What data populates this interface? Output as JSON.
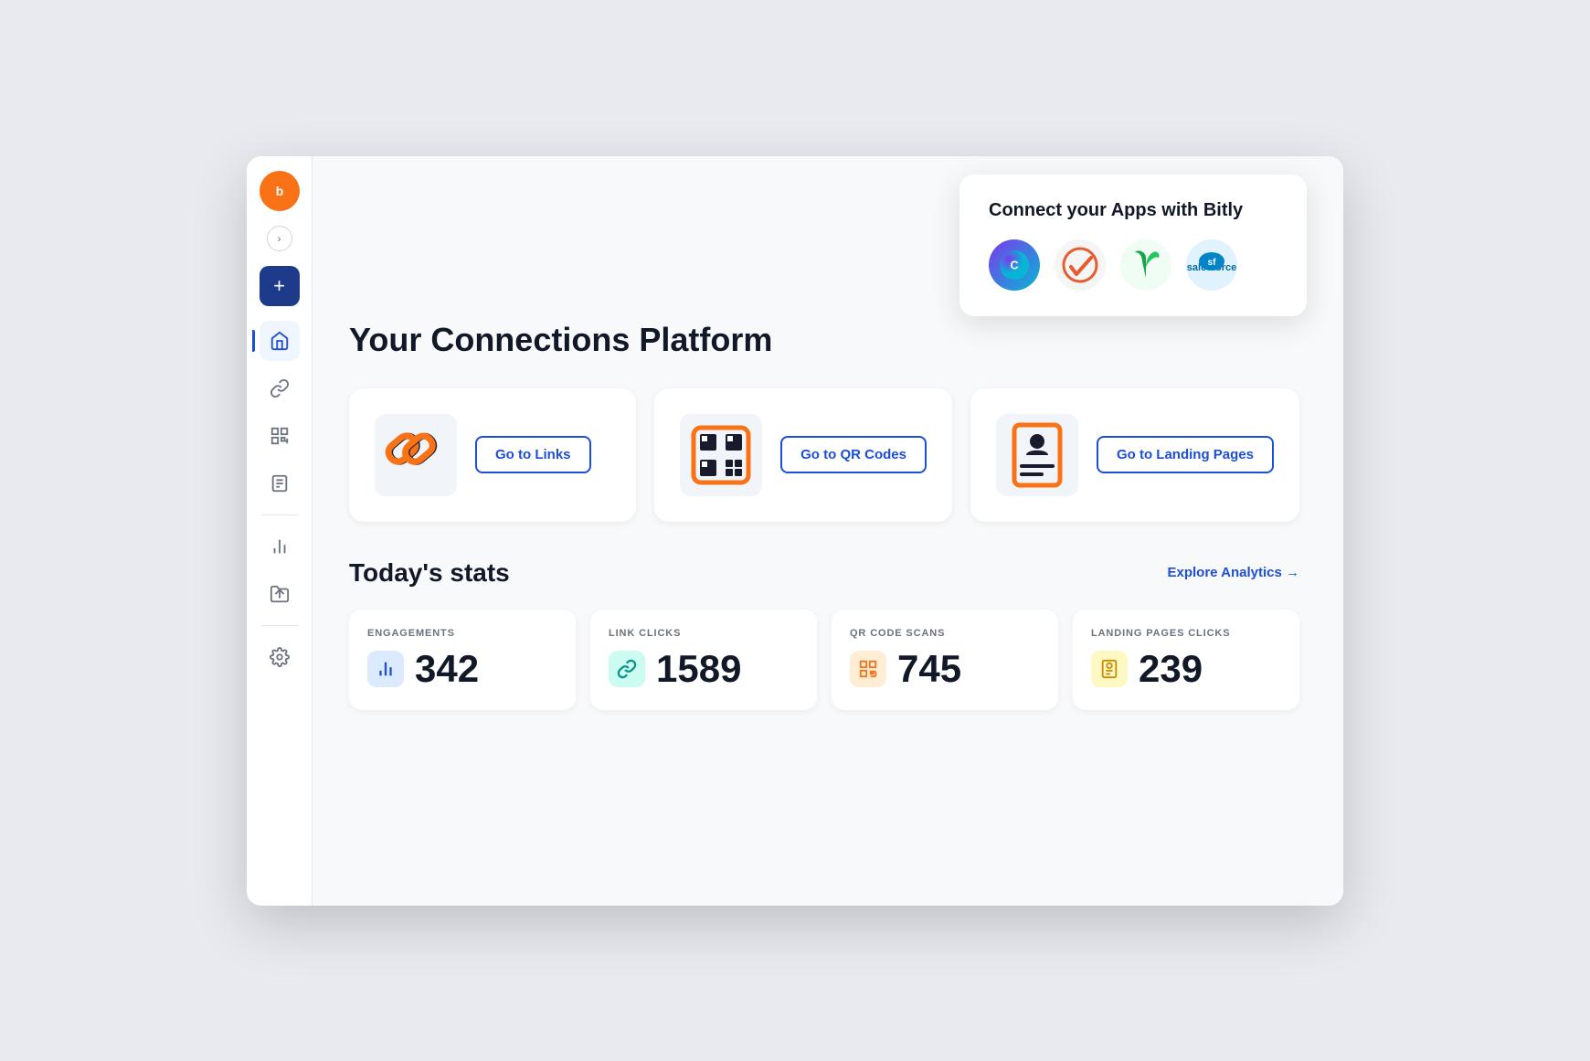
{
  "sidebar": {
    "logo_alt": "Bitly logo",
    "toggle_label": ">",
    "create_label": "+",
    "items": [
      {
        "id": "home",
        "label": "Home",
        "active": true
      },
      {
        "id": "links",
        "label": "Links",
        "active": false
      },
      {
        "id": "qr-codes",
        "label": "QR Codes",
        "active": false
      },
      {
        "id": "pages",
        "label": "Landing Pages",
        "active": false
      },
      {
        "id": "analytics",
        "label": "Analytics",
        "active": false
      },
      {
        "id": "campaigns",
        "label": "Campaigns",
        "active": false
      }
    ]
  },
  "connect_card": {
    "title": "Connect your Apps with Bitly",
    "apps": [
      {
        "id": "canva",
        "label": "Canva"
      },
      {
        "id": "check",
        "label": "Check"
      },
      {
        "id": "sprout",
        "label": "Sprout"
      },
      {
        "id": "salesforce",
        "label": "Salesforce"
      }
    ]
  },
  "main": {
    "page_title": "Your Connections Platform",
    "nav_cards": [
      {
        "id": "links",
        "button_label": "Go to Links"
      },
      {
        "id": "qr-codes",
        "button_label": "Go to QR Codes"
      },
      {
        "id": "landing-pages",
        "button_label": "Go to Landing Pages"
      }
    ],
    "stats": {
      "title": "Today's stats",
      "explore_label": "Explore Analytics →",
      "items": [
        {
          "id": "engagements",
          "label": "ENGAGEMENTS",
          "value": "342",
          "color": "#dbeafe",
          "icon_color": "#1d4ed8"
        },
        {
          "id": "link-clicks",
          "label": "LINK CLICKS",
          "value": "1589",
          "color": "#ccfbf1",
          "icon_color": "#0d9488"
        },
        {
          "id": "qr-scans",
          "label": "QR CODE SCANS",
          "value": "745",
          "color": "#ffedd5",
          "icon_color": "#f97316"
        },
        {
          "id": "lp-clicks",
          "label": "LANDING PAGES CLICKS",
          "value": "239",
          "color": "#fef9c3",
          "icon_color": "#ca8a04"
        }
      ]
    }
  }
}
